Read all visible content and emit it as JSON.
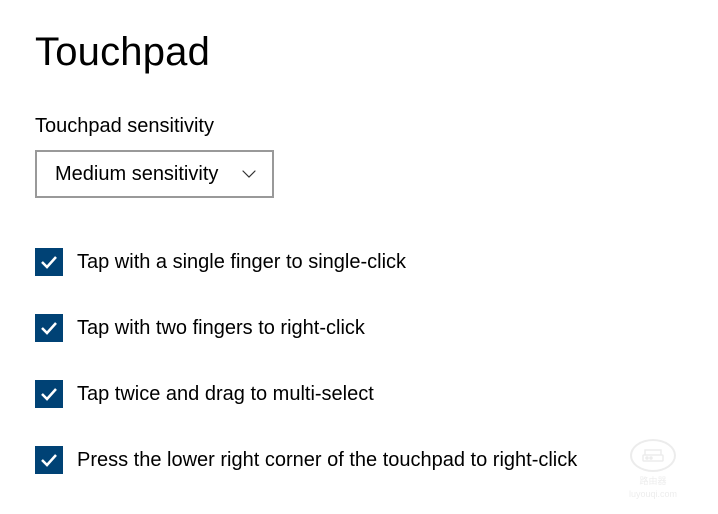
{
  "page": {
    "title": "Touchpad"
  },
  "sensitivity": {
    "label": "Touchpad sensitivity",
    "selected": "Medium sensitivity"
  },
  "checkboxes": [
    {
      "label": "Tap with a single finger to single-click",
      "checked": true
    },
    {
      "label": "Tap with two fingers to right-click",
      "checked": true
    },
    {
      "label": "Tap twice and drag to multi-select",
      "checked": true
    },
    {
      "label": "Press the lower right corner of the touchpad to right-click",
      "checked": true
    }
  ],
  "watermark": {
    "title": "路由器",
    "subtitle": "luyouqi.com"
  }
}
